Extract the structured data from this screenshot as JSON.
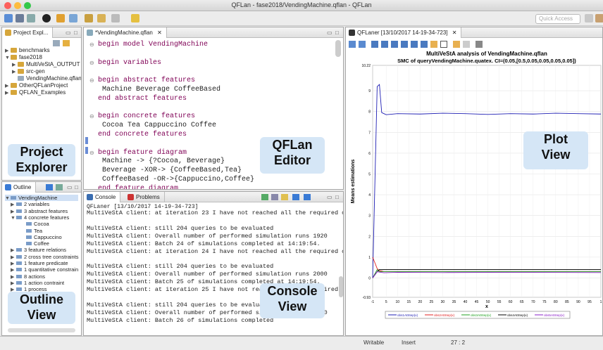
{
  "window": {
    "title": "QFLan - fase2018/VendingMachine.qflan - QFLan"
  },
  "toolbar": {
    "quick_access_placeholder": "Quick Access"
  },
  "project_explorer": {
    "tab_label": "Project Expl...",
    "items": [
      {
        "label": "benchmarks",
        "type": "project"
      },
      {
        "label": "fase2018",
        "type": "project"
      },
      {
        "label": "MultiVeStA_OUTPUT",
        "type": "folder"
      },
      {
        "label": "src-gen",
        "type": "folder"
      },
      {
        "label": "VendingMachine.qflan",
        "type": "file"
      },
      {
        "label": "OtherQFLanProject",
        "type": "project"
      },
      {
        "label": "QFLAN_Examples",
        "type": "project"
      }
    ],
    "overlay_label": [
      "Project",
      "Explorer"
    ]
  },
  "outline": {
    "tab_label": "Outline",
    "items": [
      {
        "label": "VendingMachine"
      },
      {
        "label": "2 variables"
      },
      {
        "label": "3 abstract features"
      },
      {
        "label": "4 concrete features"
      },
      {
        "label": "Cocoa"
      },
      {
        "label": "Tea"
      },
      {
        "label": "Cappuccino"
      },
      {
        "label": "Coffee"
      },
      {
        "label": "3 feature relations"
      },
      {
        "label": "2 cross tree constraints"
      },
      {
        "label": "1 feature predicate"
      },
      {
        "label": "1 quantitative constrain"
      },
      {
        "label": "8 actions"
      },
      {
        "label": "1 action contraint"
      },
      {
        "label": "1 process"
      }
    ],
    "overlay_label": [
      "Outline",
      "View"
    ]
  },
  "editor": {
    "tab_label": "*VendingMachine.qflan",
    "lines": [
      "begin model VendingMachine",
      "",
      "begin variables",
      "",
      "begin abstract features",
      " Machine Beverage CoffeeBased",
      "end abstract features",
      "",
      "begin concrete features",
      " Cocoa Tea Cappuccino Coffee",
      "end concrete features",
      "",
      "begin feature diagram",
      " Machine -> {?Cocoa, Beverage}",
      " Beverage -XOR-> {CoffeeBased,Tea}",
      " CoffeeBased -OR->{Cappuccino,Coffee}",
      "end feature diagram"
    ],
    "overlay_label": [
      "QFLan",
      "Editor"
    ]
  },
  "console": {
    "tab_label": "Console",
    "tab2_label": "Problems",
    "header": "QFLaner [13/10/2017 14-19-34-723]",
    "lines": [
      "MultiVeStA client: at iteration 23 I have not reached all the required conf",
      "",
      "MultiVeStA client: still 204 queries to be evaluated",
      "MultiVeStA client: Overall number of performed simulation runs 1920",
      "MultiVeStA client: Batch 24 of simulations completed at 14:19:54.",
      "MultiVeStA client: at iteration 24 I have not reached all the required conf",
      "",
      "MultiVeStA client: still 204 queries to be evaluated",
      "MultiVeStA client: Overall number of performed simulation runs 2000",
      "MultiVeStA client: Batch 25 of simulations completed at 14:19:54.",
      "MultiVeStA client: at iteration 25 I have not reached all the required conf",
      "",
      "MultiVeStA client: still 204 queries to be evaluated",
      "MultiVeStA client: Overall number of performed simulation runs 2080",
      "MultiVeStA client: Batch 26 of simulations completed"
    ],
    "overlay_label": [
      "Console",
      "View"
    ]
  },
  "plot": {
    "tab_label": "QFLaner [13/10/2017 14-19-34-723]",
    "overlay_label": [
      "Plot",
      "View"
    ]
  },
  "chart_data": {
    "type": "line",
    "title": "MultiVeStA analysis of VendingMachine.qflan",
    "subtitle": "SMC of queryVendingMachine.quatex. CI=(0.05,[0.5,0.05,0.05,0.05,0.05])",
    "xlabel": "x",
    "ylabel": "Means estimations",
    "xlim": [
      -1,
      100
    ],
    "ylim": [
      -0.93,
      10.22
    ],
    "x_ticks": [
      "-1",
      "5",
      "10",
      "15",
      "20",
      "25",
      "30",
      "35",
      "40",
      "45",
      "50",
      "55",
      "60",
      "65",
      "70",
      "75",
      "80",
      "85",
      "90",
      "95",
      "1"
    ],
    "y_ticks": [
      "-0.93",
      "0",
      "1",
      "2",
      "3",
      "4",
      "5",
      "6",
      "7",
      "8",
      "9",
      "10.22"
    ],
    "series": [
      {
        "name": "obs1AtStep(x)",
        "color": "#1f1fb4",
        "x": [
          -1,
          1,
          2,
          3,
          4,
          5,
          10,
          20,
          30,
          40,
          50,
          60,
          70,
          80,
          90,
          100
        ],
        "y": [
          0,
          9.2,
          9.3,
          7.95,
          7.9,
          7.85,
          7.9,
          7.88,
          7.92,
          7.9,
          7.86,
          7.9,
          7.88,
          7.92,
          7.9,
          7.88
        ]
      },
      {
        "name": "obs2AtStep(x)",
        "color": "#e02020",
        "x": [
          -1,
          1,
          2,
          4,
          10,
          30,
          60,
          100
        ],
        "y": [
          1.0,
          0.45,
          0.35,
          0.3,
          0.3,
          0.3,
          0.3,
          0.3
        ]
      },
      {
        "name": "obs3AtStep(x)",
        "color": "#20a020",
        "x": [
          -1,
          1,
          2,
          4,
          10,
          30,
          60,
          100
        ],
        "y": [
          0,
          0.4,
          0.3,
          0.3,
          0.3,
          0.3,
          0.3,
          0.3
        ]
      },
      {
        "name": "obs4AtStep(x)",
        "color": "#000000",
        "x": [
          -1,
          1,
          2,
          4,
          10,
          30,
          60,
          100
        ],
        "y": [
          0,
          0.3,
          0.4,
          0.4,
          0.4,
          0.4,
          0.4,
          0.4
        ]
      },
      {
        "name": "obs5AtStep(x)",
        "color": "#8a20c8",
        "x": [
          -1,
          1,
          2,
          4,
          10,
          30,
          60,
          100
        ],
        "y": [
          0,
          0.3,
          0.28,
          0.25,
          0.27,
          0.26,
          0.27,
          0.26
        ]
      }
    ],
    "legend_position": "bottom"
  },
  "status": {
    "mode1": "Writable",
    "mode2": "Insert",
    "position": "27 : 2"
  }
}
